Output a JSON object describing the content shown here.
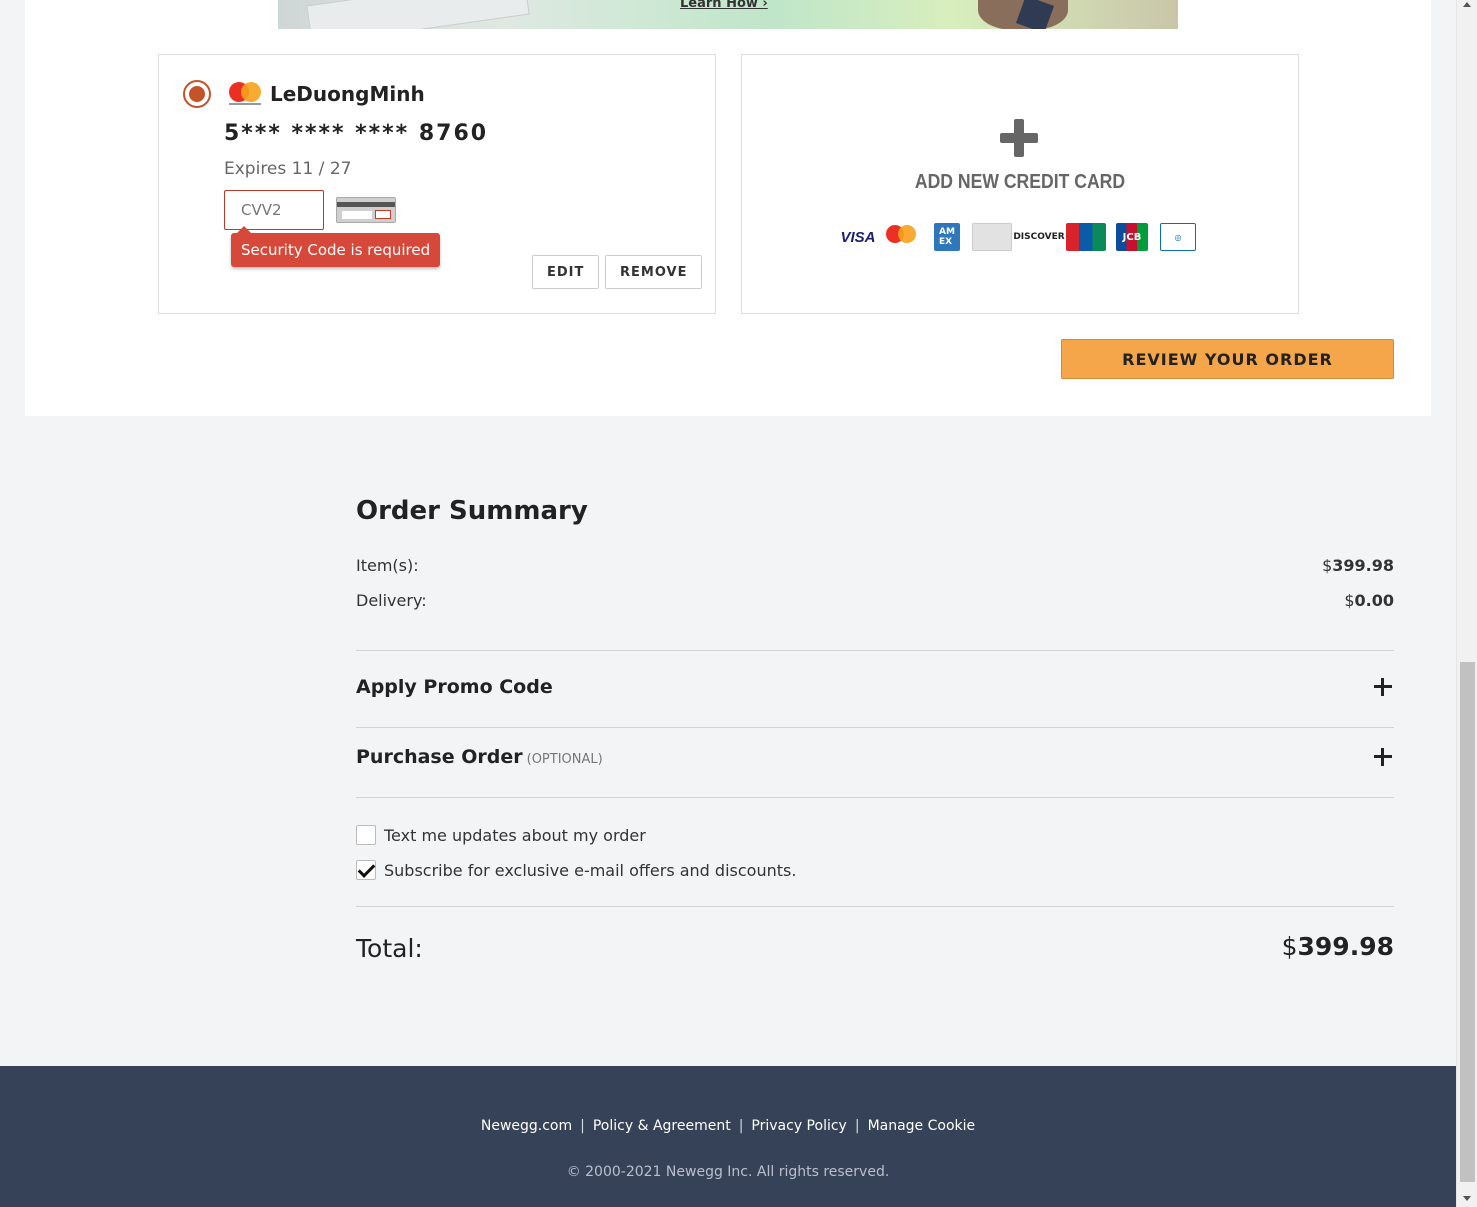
{
  "banner": {
    "link_text": "Learn How ›"
  },
  "saved_card": {
    "brand_icon": "mastercard-icon",
    "holder": "LeDuongMinh",
    "number": "5*** **** **** 8760",
    "expires": "Expires 11 / 27",
    "cvv_placeholder": "CVV2",
    "cvv_value": "",
    "error": "Security Code is required",
    "edit_label": "EDIT",
    "remove_label": "REMOVE",
    "selected": true
  },
  "add_card": {
    "label": "ADD NEW CREDIT CARD",
    "brands": [
      "VISA",
      "Mastercard",
      "AMEX",
      "Card",
      "DISCOVER",
      "UnionPay",
      "JCB",
      "Diners Club"
    ]
  },
  "review_button": "REVIEW YOUR ORDER",
  "summary": {
    "title": "Order Summary",
    "items_label": "Item(s):",
    "items_currency": "$",
    "items_value": "399.98",
    "delivery_label": "Delivery:",
    "delivery_currency": "$",
    "delivery_value": "0.00",
    "promo_label": "Apply Promo Code",
    "po_label": "Purchase Order",
    "po_optional": "(OPTIONAL)",
    "text_updates_label": "Text me updates about my order",
    "text_updates_checked": false,
    "subscribe_label": "Subscribe for exclusive e-mail offers and discounts.",
    "subscribe_checked": true,
    "total_label": "Total:",
    "total_currency": "$",
    "total_value": "399.98"
  },
  "footer": {
    "links": [
      "Newegg.com",
      "Policy & Agreement",
      "Privacy Policy",
      "Manage Cookie"
    ],
    "separator": "|",
    "copyright": "© 2000-2021 Newegg Inc. All rights reserved."
  },
  "colors": {
    "accent_orange": "#f5a54a",
    "error_red": "#d6483a",
    "radio_selected": "#c4532a",
    "footer_bg": "#364257",
    "page_bg": "#f3f4f6"
  }
}
